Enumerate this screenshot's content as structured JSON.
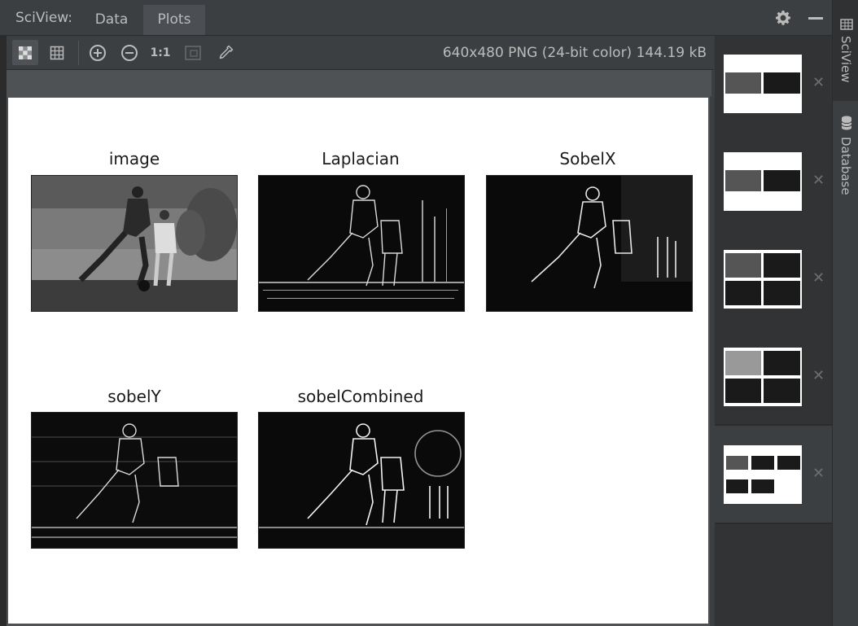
{
  "header": {
    "app_label": "SciView:",
    "tabs": [
      {
        "label": "Data"
      },
      {
        "label": "Plots"
      }
    ]
  },
  "toolbar": {
    "zoom_reset_label": "1:1",
    "image_info": "640x480 PNG (24-bit color) 144.19 kB"
  },
  "plot": {
    "subplots": [
      {
        "title": "image"
      },
      {
        "title": "Laplacian"
      },
      {
        "title": "SobelX"
      },
      {
        "title": "sobelY"
      },
      {
        "title": "sobelCombined"
      }
    ]
  },
  "side_stripe": {
    "sciview_label": "SciView",
    "database_label": "Database"
  },
  "thumbnails": {
    "count": 5,
    "selected_index": 4
  }
}
